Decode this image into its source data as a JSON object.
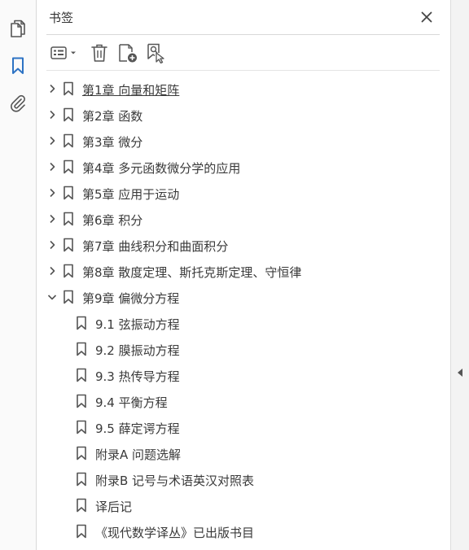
{
  "panel": {
    "title": "书签"
  },
  "rail": {
    "items": [
      {
        "name": "pages-icon",
        "active": false
      },
      {
        "name": "bookmark-icon",
        "active": true
      },
      {
        "name": "attachment-icon",
        "active": false
      }
    ]
  },
  "toolbar": {
    "buttons": [
      "options-menu-icon",
      "delete-icon",
      "new-bookmark-icon",
      "bookmark-from-selection-icon"
    ]
  },
  "bookmarks": [
    {
      "label": "第1章  向量和矩阵",
      "level": 0,
      "expandable": true,
      "expanded": false,
      "selected": true
    },
    {
      "label": "第2章  函数",
      "level": 0,
      "expandable": true,
      "expanded": false
    },
    {
      "label": "第3章  微分",
      "level": 0,
      "expandable": true,
      "expanded": false
    },
    {
      "label": "第4章  多元函数微分学的应用",
      "level": 0,
      "expandable": true,
      "expanded": false
    },
    {
      "label": "第5章  应用于运动",
      "level": 0,
      "expandable": true,
      "expanded": false
    },
    {
      "label": "第6章  积分",
      "level": 0,
      "expandable": true,
      "expanded": false
    },
    {
      "label": "第7章  曲线积分和曲面积分",
      "level": 0,
      "expandable": true,
      "expanded": false
    },
    {
      "label": "第8章  散度定理、斯托克斯定理、守恒律",
      "level": 0,
      "expandable": true,
      "expanded": false
    },
    {
      "label": "第9章  偏微分方程",
      "level": 0,
      "expandable": true,
      "expanded": true
    },
    {
      "label": "9.1  弦振动方程",
      "level": 1,
      "expandable": false
    },
    {
      "label": "9.2  膜振动方程",
      "level": 1,
      "expandable": false
    },
    {
      "label": "9.3  热传导方程",
      "level": 1,
      "expandable": false
    },
    {
      "label": "9.4  平衡方程",
      "level": 1,
      "expandable": false
    },
    {
      "label": "9.5  薛定谔方程",
      "level": 1,
      "expandable": false
    },
    {
      "label": "附录A  问题选解",
      "level": 1,
      "expandable": false
    },
    {
      "label": "附录B  记号与术语英汉对照表",
      "level": 1,
      "expandable": false
    },
    {
      "label": "译后记",
      "level": 1,
      "expandable": false
    },
    {
      "label": "《现代数学译丛》已出版书目",
      "level": 1,
      "expandable": false
    }
  ],
  "colors": {
    "accent": "#2d73c4",
    "icon": "#555555",
    "text": "#3a3a3a"
  }
}
